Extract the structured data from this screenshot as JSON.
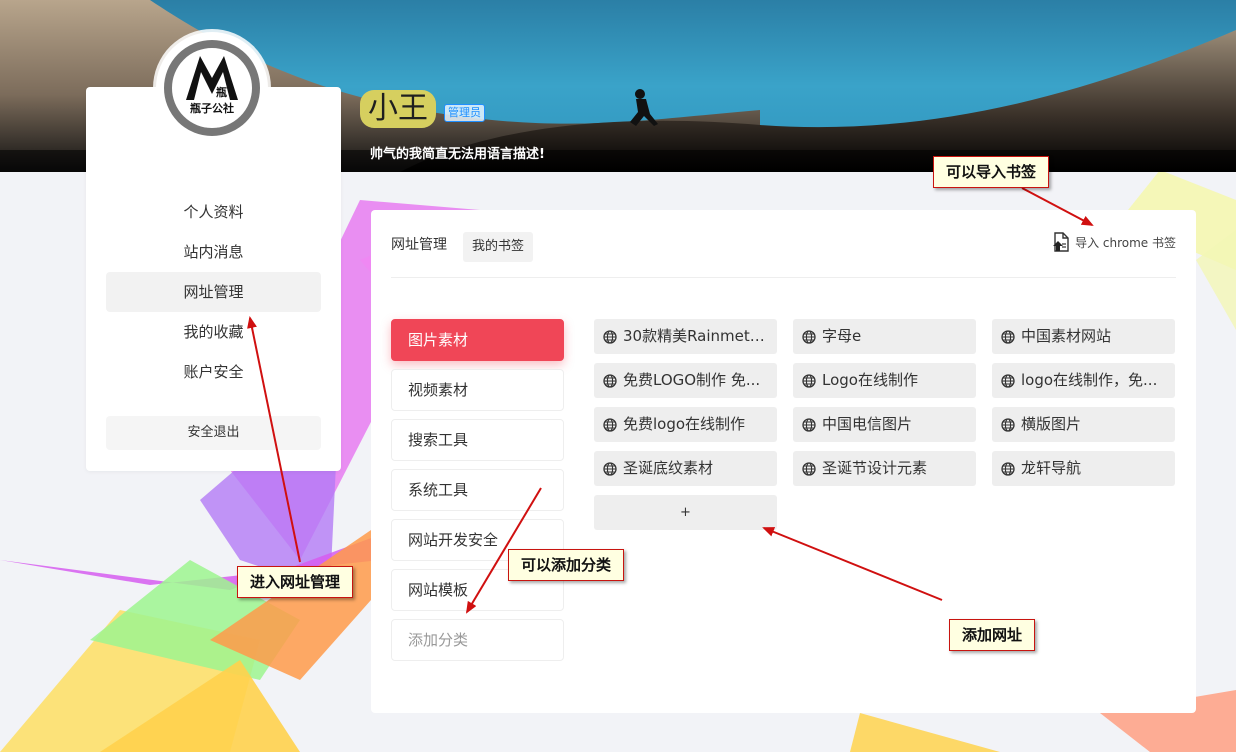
{
  "profile": {
    "name": "小王",
    "role": "管理员",
    "bio": "帅气的我简直无法用语言描述!",
    "logo_text": [
      "瓶",
      "瓶子公社"
    ]
  },
  "sidebar": {
    "items": [
      {
        "label": "个人资料",
        "active": false
      },
      {
        "label": "站内消息",
        "active": false
      },
      {
        "label": "网址管理",
        "active": true
      },
      {
        "label": "我的收藏",
        "active": false
      },
      {
        "label": "账户安全",
        "active": false
      }
    ],
    "logout_label": "安全退出"
  },
  "main": {
    "title": "网址管理",
    "tab": "我的书签",
    "import_label": "导入 chrome 书签",
    "categories": [
      {
        "label": "图片素材",
        "active": true
      },
      {
        "label": "视频素材",
        "active": false
      },
      {
        "label": "搜索工具",
        "active": false
      },
      {
        "label": "系统工具",
        "active": false
      },
      {
        "label": "网站开发安全",
        "active": false
      },
      {
        "label": "网站模板",
        "active": false
      }
    ],
    "add_category_label": "添加分类",
    "links": [
      "30款精美Rainmeter...",
      "字母e",
      "中国素材网站",
      "免费LOGO制作 免...",
      "Logo在线制作",
      "logo在线制作，免...",
      "免费logo在线制作",
      "中国电信图片",
      "横版图片",
      "圣诞底纹素材",
      "圣诞节设计元素",
      "龙轩导航"
    ],
    "add_link_label": "+"
  },
  "annotations": {
    "import": "可以导入书签",
    "manage": "进入网址管理",
    "add_category": "可以添加分类",
    "add_link": "添加网址"
  },
  "colors": {
    "accent": "#f04657",
    "badge": "#1f8fff",
    "annotation_border": "#c8140f",
    "annotation_bg": "#ffffe1"
  }
}
